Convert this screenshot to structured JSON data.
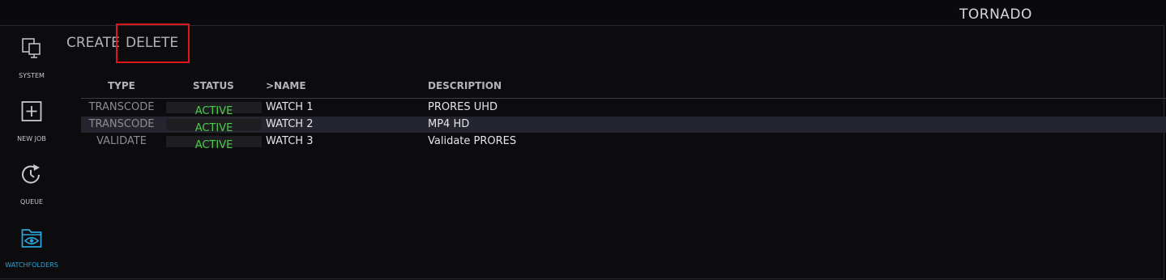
{
  "app": {
    "brand": "TORNADO"
  },
  "sidebar": {
    "items": [
      {
        "label": "SYSTEM",
        "icon": "system-monitor-icon",
        "active": false
      },
      {
        "label": "NEW JOB",
        "icon": "plus-square-icon",
        "active": false
      },
      {
        "label": "QUEUE",
        "icon": "clock-refresh-icon",
        "active": false
      },
      {
        "label": "WATCHFOLDERS",
        "icon": "folder-eye-icon",
        "active": true
      }
    ]
  },
  "toolbar": {
    "create_label": "CREATE",
    "delete_label": "DELETE"
  },
  "table": {
    "columns": [
      "TYPE",
      "STATUS",
      ">NAME",
      "DESCRIPTION"
    ],
    "rows": [
      {
        "type": "TRANSCODE",
        "status": "ACTIVE",
        "name": "WATCH 1",
        "description": "PRORES UHD",
        "selected": false
      },
      {
        "type": "TRANSCODE",
        "status": "ACTIVE",
        "name": "WATCH 2",
        "description": "MP4 HD",
        "selected": true
      },
      {
        "type": "VALIDATE",
        "status": "ACTIVE",
        "name": "WATCH 3",
        "description": "Validate PRORES",
        "selected": false
      }
    ]
  },
  "colors": {
    "accent": "#2aa4d8",
    "status_active": "#4ecb4e",
    "highlight_box": "#e0141c",
    "selected_row": "#25252f"
  }
}
